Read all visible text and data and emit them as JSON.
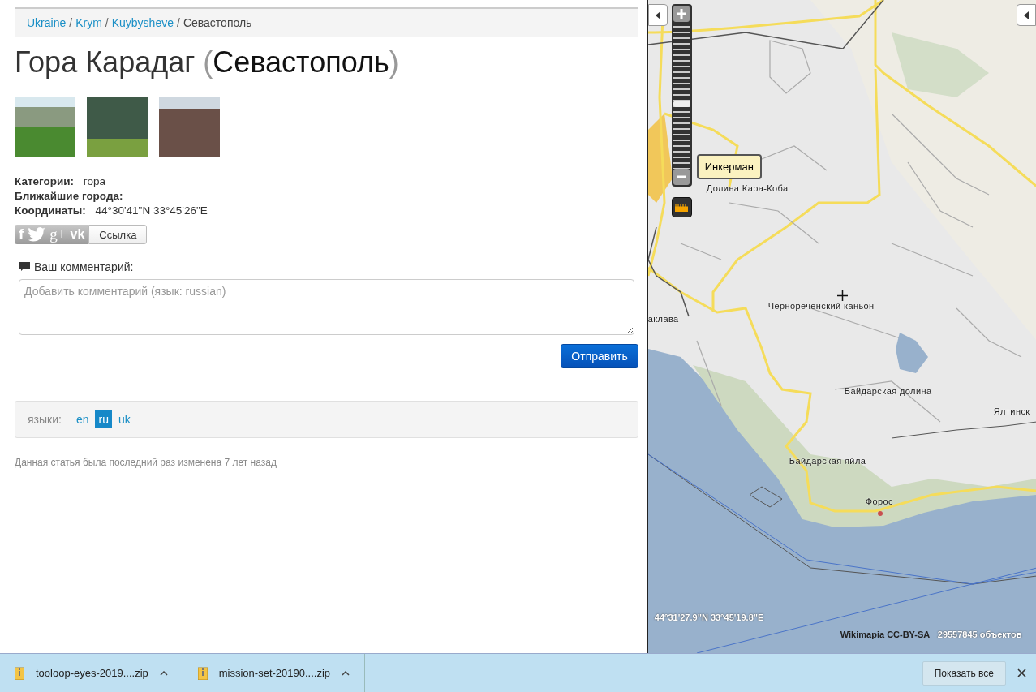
{
  "breadcrumb": [
    {
      "label": "Ukraine",
      "link": true
    },
    {
      "label": "Krym",
      "link": true
    },
    {
      "label": "Kuybysheve",
      "link": true
    },
    {
      "label": "Севастополь",
      "link": false
    }
  ],
  "breadcrumb_separator": "/",
  "title": [
    {
      "text": "Гора Карадаг",
      "kind": "name"
    },
    {
      "text": "(",
      "kind": "paren"
    },
    {
      "text": "Севастополь",
      "kind": "city"
    },
    {
      "text": ")",
      "kind": "paren"
    }
  ],
  "fields": [
    {
      "label": "Категории:",
      "value": "гора"
    },
    {
      "label": "Ближайшие города:"
    },
    {
      "label": "Координаты:",
      "value": "44°30'41\"N 33°45'26\"E"
    }
  ],
  "share_buttons": [
    {
      "kind": "facebook",
      "glyph": "f"
    },
    {
      "kind": "twitter"
    },
    {
      "kind": "google",
      "glyph": "g+"
    },
    {
      "kind": "vk",
      "glyph": "vk"
    }
  ],
  "link_button": "Ссылка",
  "comment": {
    "label": "Ваш комментарий:",
    "placeholder": "Добавить комментарий (язык: russian)",
    "submit": "Отправить"
  },
  "languages": {
    "label": "языки:",
    "items": [
      {
        "code": "en",
        "selected": false
      },
      {
        "code": "ru",
        "selected": true
      },
      {
        "code": "uk",
        "selected": false
      }
    ]
  },
  "footer_note": "Данная статья была последний раз изменена 7 лет назад",
  "map": {
    "tooltip": "Инкерман",
    "zoom": {
      "level": 0.45
    },
    "labels": [
      {
        "text": "Долина Кара-Коба"
      },
      {
        "text": "Чернореченский каньон"
      },
      {
        "text": "аклава"
      },
      {
        "text": "Байдарская долина"
      },
      {
        "text": "Ялтинск"
      },
      {
        "text": "Байдарская яйла"
      },
      {
        "text": "Форос"
      }
    ],
    "coordinates": "44°31'27.9\"N 33°45'19.8\"E",
    "attribution": "Wikimapia CC-BY-SA",
    "object_count": "29557845 объектов"
  },
  "downloads": [
    {
      "name": "tooloop-eyes-2019....zip"
    },
    {
      "name": "mission-set-20190....zip"
    }
  ],
  "show_all_button": "Показать все"
}
